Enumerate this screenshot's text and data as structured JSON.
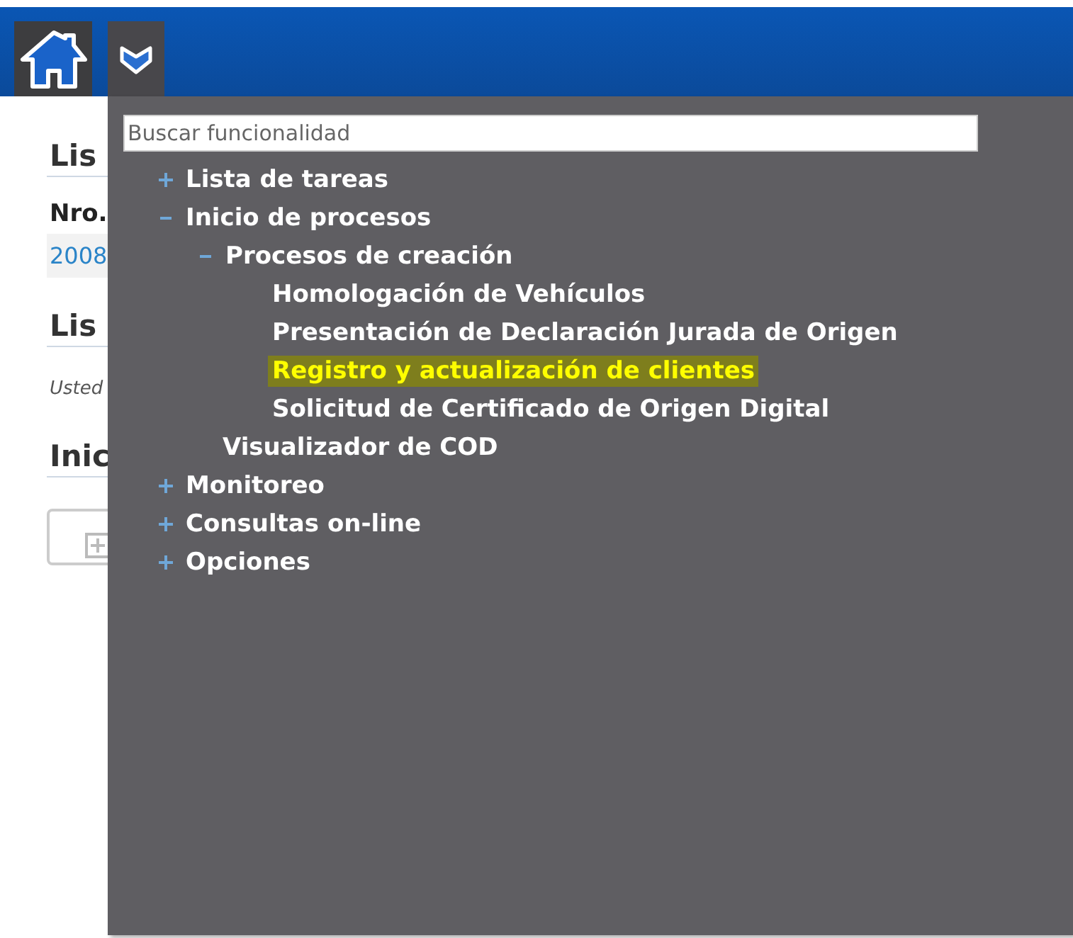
{
  "page": {
    "sections": [
      {
        "kind": "table",
        "title": "Lis",
        "columns": [
          "Nro."
        ],
        "rows": [
          [
            "2008"
          ]
        ]
      },
      {
        "kind": "message",
        "title": "Lis",
        "message": "Usted"
      },
      {
        "kind": "tiles",
        "title": "Inic"
      }
    ]
  },
  "menu": {
    "open": true,
    "search": {
      "placeholder": "Buscar funcionalidad"
    },
    "items": [
      {
        "label": "Lista de tareas",
        "expanded": false,
        "selected": false
      },
      {
        "label": "Inicio de procesos",
        "expanded": true,
        "selected": false,
        "children": [
          {
            "label": "Procesos de creación",
            "expanded": true,
            "selected": false,
            "children": [
              {
                "label": "Homologación de Vehículos",
                "selected": false
              },
              {
                "label": "Presentación de Declaración Jurada de Origen",
                "selected": false
              },
              {
                "label": "Registro y actualización de clientes",
                "selected": true
              },
              {
                "label": "Solicitud de Certificado de Origen Digital",
                "selected": false
              }
            ]
          },
          {
            "label": "Visualizador de COD",
            "selected": false
          }
        ]
      },
      {
        "label": "Monitoreo",
        "expanded": false,
        "selected": false
      },
      {
        "label": "Consultas on-line",
        "expanded": false,
        "selected": false
      },
      {
        "label": "Opciones",
        "expanded": false,
        "selected": false
      }
    ]
  }
}
